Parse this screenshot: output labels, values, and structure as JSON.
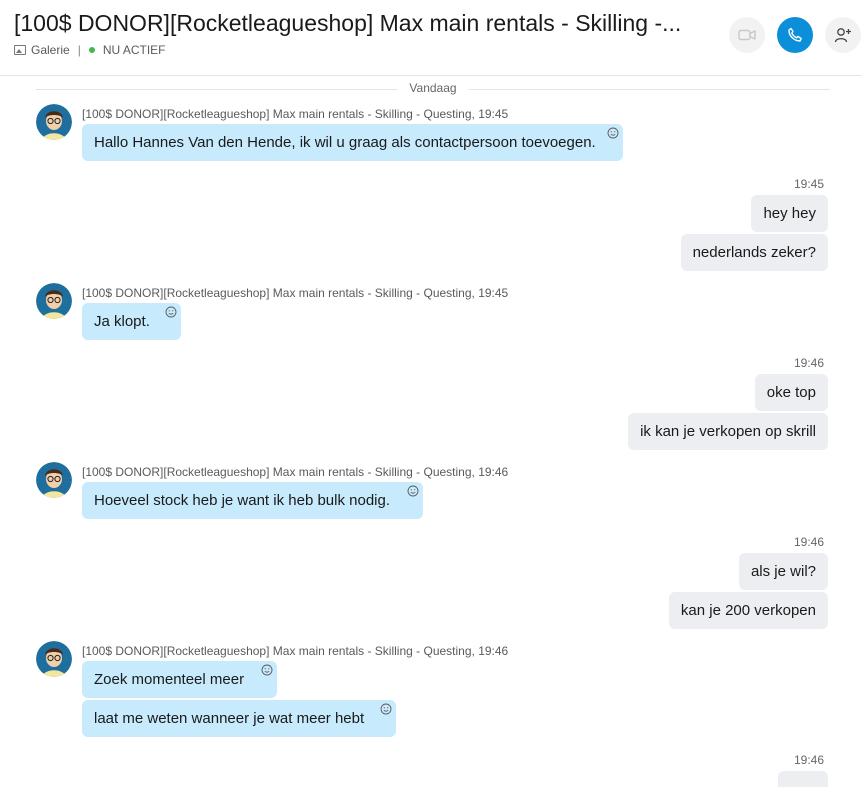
{
  "header": {
    "title": "[100$ DONOR][Rocketleagueshop] Max main rentals - Skilling -...",
    "gallery_label": "Galerie",
    "separator": "|",
    "status_label": "NU ACTIEF",
    "status_color": "#3fb950",
    "buttons": [
      {
        "name": "video-call-icon",
        "color": "#f2f2f2"
      },
      {
        "name": "phone-icon",
        "color": "#0a8fd8"
      },
      {
        "name": "add-person-icon",
        "color": "#f2f2f2"
      }
    ]
  },
  "chat": {
    "day_label": "Vandaag",
    "sender_name": "[100$ DONOR][Rocketleagueshop] Max main rentals - Skilling - Questing",
    "groups": [
      {
        "direction": "in",
        "time": "19:45",
        "messages": [
          "Hallo Hannes Van den Hende, ik wil u graag als contactpersoon toevoegen."
        ]
      },
      {
        "direction": "out",
        "time": "19:45",
        "messages": [
          "hey hey",
          "nederlands zeker?"
        ]
      },
      {
        "direction": "in",
        "time": "19:45",
        "messages": [
          "Ja klopt."
        ]
      },
      {
        "direction": "out",
        "time": "19:46",
        "messages": [
          "oke top",
          "ik kan je verkopen op skrill"
        ]
      },
      {
        "direction": "in",
        "time": "19:46",
        "messages": [
          "Hoeveel stock heb je want ik heb bulk nodig."
        ]
      },
      {
        "direction": "out",
        "time": "19:46",
        "messages": [
          "als je wil?",
          "kan je 200 verkopen"
        ]
      },
      {
        "direction": "in",
        "time": "19:46",
        "messages": [
          "Zoek momenteel meer",
          "laat me weten wanneer je wat meer hebt"
        ]
      },
      {
        "direction": "out",
        "time": "19:46",
        "messages": []
      }
    ]
  },
  "colors": {
    "incoming_bubble": "#c7eafd",
    "outgoing_bubble": "#eceef2",
    "accent": "#0a8fd8"
  }
}
